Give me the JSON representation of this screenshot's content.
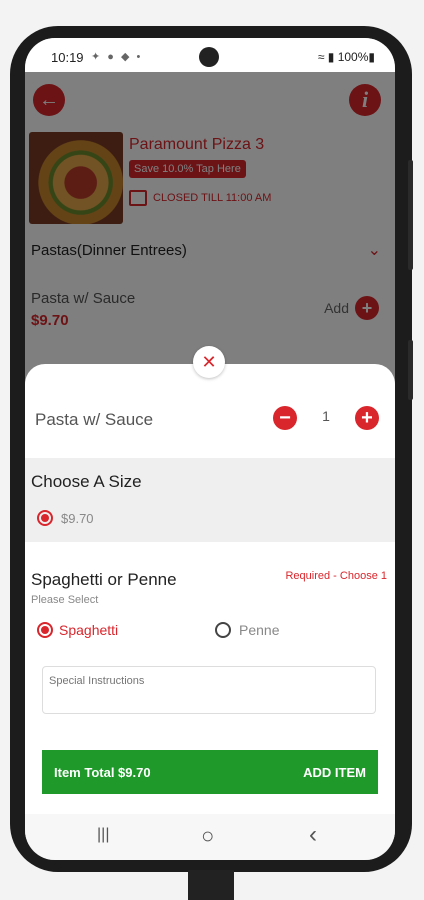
{
  "status_bar": {
    "time": "10:19",
    "icons": "✦ ● ◆ •",
    "right": "≈ ▮ 100%▮"
  },
  "header": {
    "back_icon": "back-arrow-icon",
    "info_label": "i"
  },
  "restaurant": {
    "name": "Paramount Pizza 3",
    "save_badge": "Save 10.0% Tap Here",
    "status": "CLOSED TILL 11:00 AM"
  },
  "category": {
    "title": "Pastas(Dinner Entrees)",
    "chevron": "⌄"
  },
  "menu_item": {
    "name": "Pasta w/ Sauce",
    "price": "$9.70",
    "add_label": "Add",
    "add_symbol": "+"
  },
  "sheet": {
    "close_symbol": "✕",
    "title": "Pasta w/ Sauce",
    "quantity": "1",
    "minus_symbol": "−",
    "plus_symbol": "+",
    "size_section": {
      "title": "Choose A Size",
      "option": "$9.70"
    },
    "pasta_section": {
      "title": "Spaghetti or Penne",
      "subtitle": "Please Select",
      "requirement": "Required - Choose 1",
      "options": [
        {
          "label": "Spaghetti",
          "selected": true
        },
        {
          "label": "Penne",
          "selected": false
        }
      ]
    },
    "instructions_placeholder": "Special Instructions",
    "item_total": "Item Total $9.70",
    "add_item": "ADD ITEM"
  },
  "nav": {
    "recents": "|||",
    "home": "○",
    "back": "‹"
  },
  "colors": {
    "accent": "#d8262c",
    "action": "#1f9a2a"
  }
}
